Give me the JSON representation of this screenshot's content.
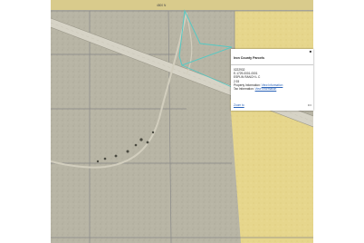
{
  "map": {
    "road_label": "4800 N",
    "colors": {
      "terrain": "#b5b2a2",
      "parcel_highlight": "#e6d68c",
      "road": "#d6d3c6",
      "parcel_lines": "#8a8a8a",
      "selected_parcel_outline": "#56c9c3",
      "trees": "#4a4a40"
    },
    "icons": {
      "close": "close-icon",
      "more": "more-menu-icon"
    }
  },
  "popup": {
    "title": "Iron County Parcels",
    "close_symbol": "■",
    "parcel_number": "0222932",
    "account_number": "E-1729-0001-0001",
    "owner": "ESPLIN RANCH L C",
    "acres": "2.93",
    "property_info_label": "Property Information:",
    "property_info_link": "View Information",
    "tax_info_label": "Tax Information:",
    "tax_info_link": "View Information",
    "zoom_link": "Zoom to",
    "more_symbol": "•••"
  }
}
